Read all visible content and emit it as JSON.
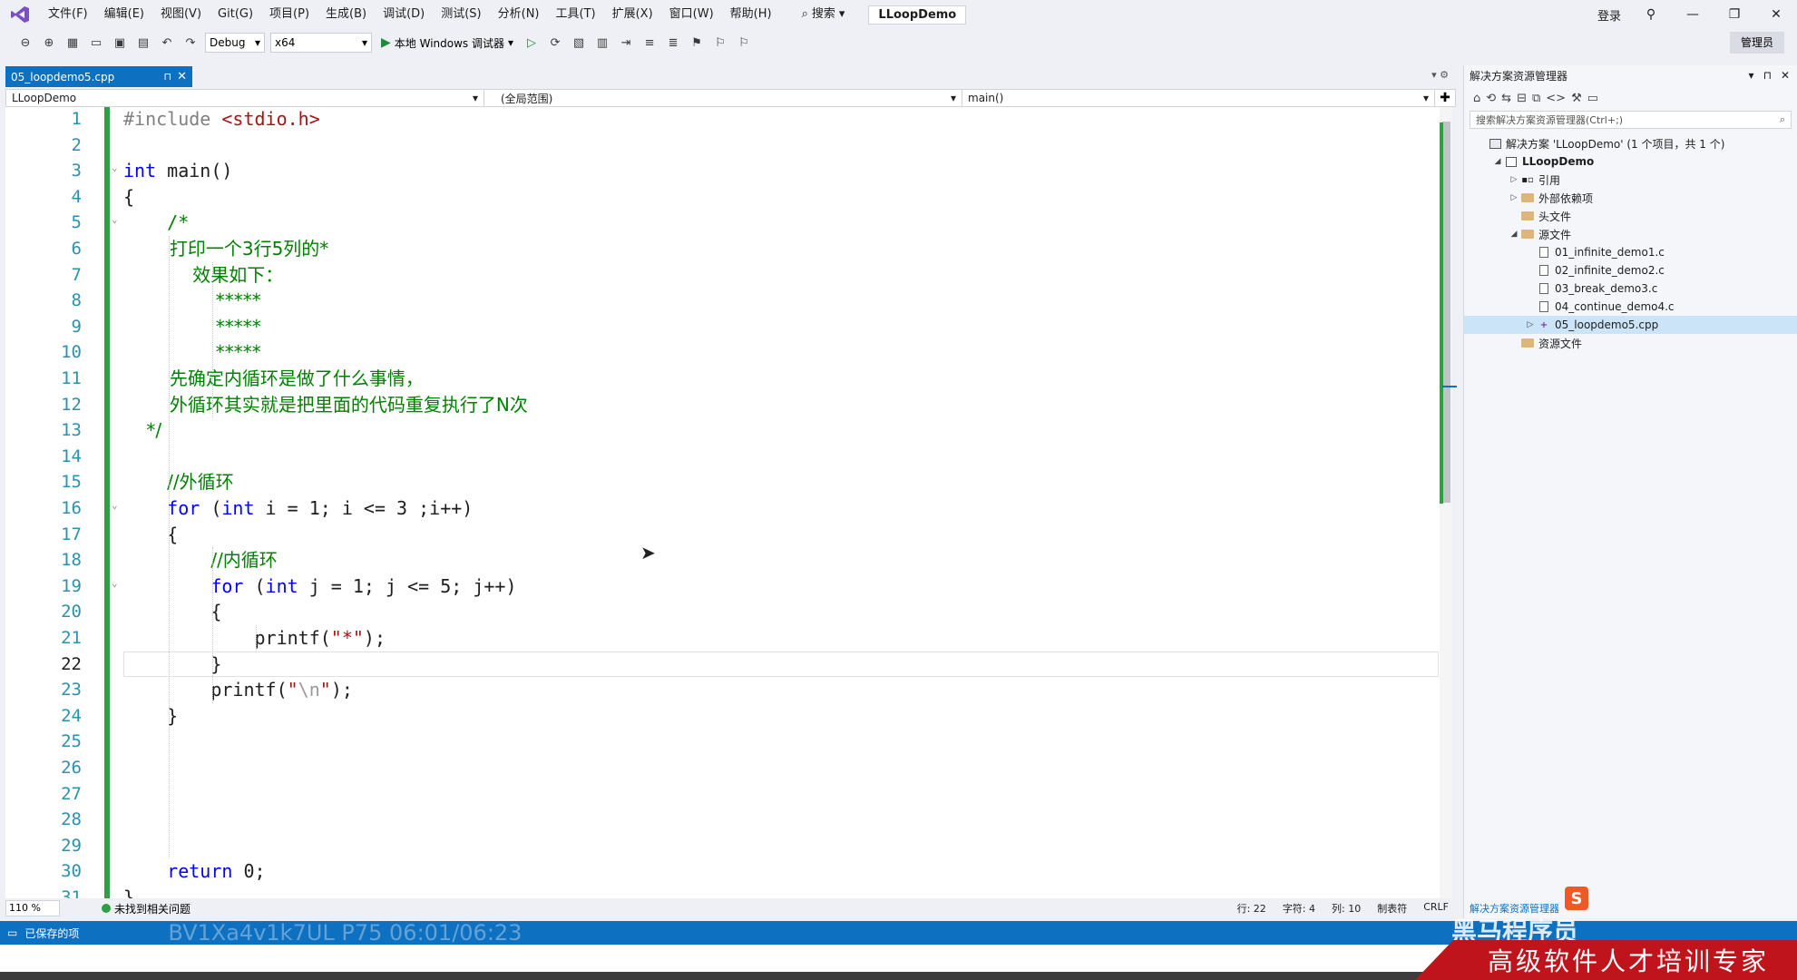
{
  "window": {
    "menus": [
      "文件(F)",
      "编辑(E)",
      "视图(V)",
      "Git(G)",
      "项目(P)",
      "生成(B)",
      "调试(D)",
      "测试(S)",
      "分析(N)",
      "工具(T)",
      "扩展(X)",
      "窗口(W)",
      "帮助(H)"
    ],
    "search_label": "搜索",
    "solution_name": "LLoopDemo",
    "login_label": "登录",
    "admin_label": "管理员"
  },
  "toolbar": {
    "config": "Debug",
    "platform": "x64",
    "run_label": "本地 Windows 调试器"
  },
  "editor": {
    "tab_name": "05_loopdemo5.cpp",
    "nav_project": "LLoopDemo",
    "nav_scope": "(全局范围)",
    "nav_member": "main()",
    "current_line": 22,
    "zoom": "110 %",
    "issues_label": "未找到相关问题",
    "row_label": "行: 22",
    "char_label": "字符: 4",
    "col_label": "列: 10",
    "tab_label": "制表符",
    "eol_label": "CRLF"
  },
  "code_lines": [
    "#include <stdio.h>",
    "",
    "int main()",
    "{",
    "    /*",
    "        打印一个3行5列的*",
    "            效果如下：",
    "                *****",
    "                *****",
    "                *****",
    "        先确定内循环是做了什么事情，",
    "        外循环其实就是把里面的代码重复执行了N次",
    "    */",
    "",
    "    //外循环",
    "    for (int i = 1; i <= 3 ;i++)",
    "    {",
    "        //内循环",
    "        for (int j = 1; j <= 5; j++)",
    "        {",
    "            printf(\"*\");",
    "        }",
    "        printf(\"\\n\");",
    "    }",
    "",
    "",
    "",
    "",
    "",
    "    return 0;",
    "}"
  ],
  "solution_explorer": {
    "title": "解决方案资源管理器",
    "search_placeholder": "搜索解决方案资源管理器(Ctrl+;)",
    "items": [
      {
        "label": "解决方案 'LLoopDemo' (1 个项目，共 1 个)",
        "level": 0,
        "expand": "",
        "icon": "solution",
        "bold": false
      },
      {
        "label": "LLoopDemo",
        "level": 1,
        "expand": "open",
        "icon": "project",
        "bold": true
      },
      {
        "label": "引用",
        "level": 2,
        "expand": "closed",
        "icon": "ref",
        "bold": false
      },
      {
        "label": "外部依赖项",
        "level": 2,
        "expand": "closed",
        "icon": "folder",
        "bold": false
      },
      {
        "label": "头文件",
        "level": 2,
        "expand": "",
        "icon": "folder",
        "bold": false
      },
      {
        "label": "源文件",
        "level": 2,
        "expand": "open",
        "icon": "folder",
        "bold": false
      },
      {
        "label": "01_infinite_demo1.c",
        "level": 3,
        "expand": "",
        "icon": "file",
        "bold": false
      },
      {
        "label": "02_infinite_demo2.c",
        "level": 3,
        "expand": "",
        "icon": "file",
        "bold": false
      },
      {
        "label": "03_break_demo3.c",
        "level": 3,
        "expand": "",
        "icon": "file",
        "bold": false
      },
      {
        "label": "04_continue_demo4.c",
        "level": 3,
        "expand": "",
        "icon": "file",
        "bold": false
      },
      {
        "label": "05_loopdemo5.cpp",
        "level": 3,
        "expand": "closed",
        "icon": "cppfile",
        "bold": false,
        "selected": true
      },
      {
        "label": "资源文件",
        "level": 2,
        "expand": "",
        "icon": "folder",
        "bold": false
      }
    ],
    "bottom_tab": "解决方案资源管理器"
  },
  "statusbar": {
    "left": "已保存的项",
    "watermark": "BV1Xa4v1k7UL P75 06:01/06:23"
  },
  "overlay": {
    "brand_top": "黑马程序员",
    "brand_sub": "高级软件人才培训专家",
    "ime": "S"
  },
  "colors": {
    "accent": "#0e70c0",
    "keyword": "#0000ff",
    "comment": "#008000",
    "string": "#a31515",
    "line_number": "#2b91af",
    "change_bar": "#2ea043"
  }
}
